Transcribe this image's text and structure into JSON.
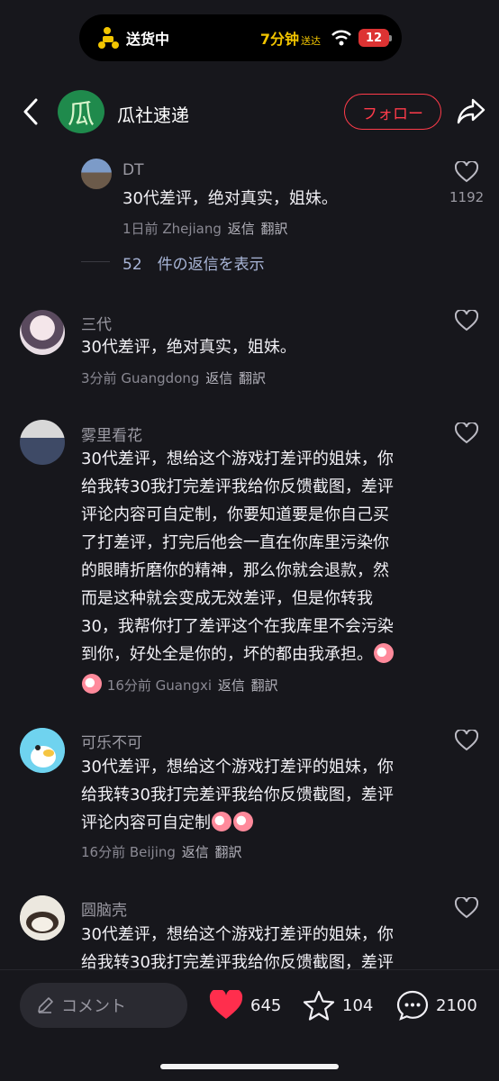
{
  "status": {
    "delivery_label": "送货中",
    "eta": "7分钟",
    "eta_suffix": "送达",
    "battery": "12"
  },
  "header": {
    "channel_avatar_text": "瓜",
    "channel_name": "瓜社速递",
    "follow_label": "フォロー"
  },
  "comments": [
    {
      "username": "DT",
      "text": "30代差评，绝对真实，姐妹。",
      "time": "1日前",
      "location": "Zhejiang",
      "reply": "返信",
      "translate": "翻訳",
      "likes": "1192",
      "replies_text": "52　件の返信を表示"
    },
    {
      "username": "三代",
      "text": "30代差评，绝对真实，姐妹。",
      "time": "3分前",
      "location": "Guangdong",
      "reply": "返信",
      "translate": "翻訳"
    },
    {
      "username": "雾里看花",
      "lines": [
        "30代差评，想给这个游戏打差评的姐妹，你",
        "给我转30我打完差评我给你反馈截图，差评",
        "评论内容可自定制，你要知道要是你自己买",
        "了打差评，打完后他会一直在你库里污染你",
        "的眼睛折磨你的精神，那么你就会退款，然",
        "而是这种就会变成无效差评，但是你转我",
        "30，我帮你打了差评这个在我库里不会污染",
        "到你，好处全是你的，坏的都由我承担。"
      ],
      "time": "16分前",
      "location": "Guangxi",
      "reply": "返信",
      "translate": "翻訳"
    },
    {
      "username": "可乐不可",
      "lines": [
        "30代差评，想给这个游戏打差评的姐妹，你",
        "给我转30我打完差评我给你反馈截图，差评",
        "评论内容可自定制"
      ],
      "time": "16分前",
      "location": "Beijing",
      "reply": "返信",
      "translate": "翻訳"
    },
    {
      "username": "圆脑壳",
      "lines": [
        "30代差评，想给这个游戏打差评的姐妹，你",
        "给我转30我打完差评我给你反馈截图，差评"
      ]
    }
  ],
  "bottom": {
    "comment_placeholder": "コメント",
    "likes": "645",
    "favorites": "104",
    "comments": "2100"
  },
  "colors": {
    "background": "#17171c",
    "accent_red": "#ff3b4a",
    "eta_yellow": "#f2c500",
    "replies_blue": "#a9b6d8"
  }
}
